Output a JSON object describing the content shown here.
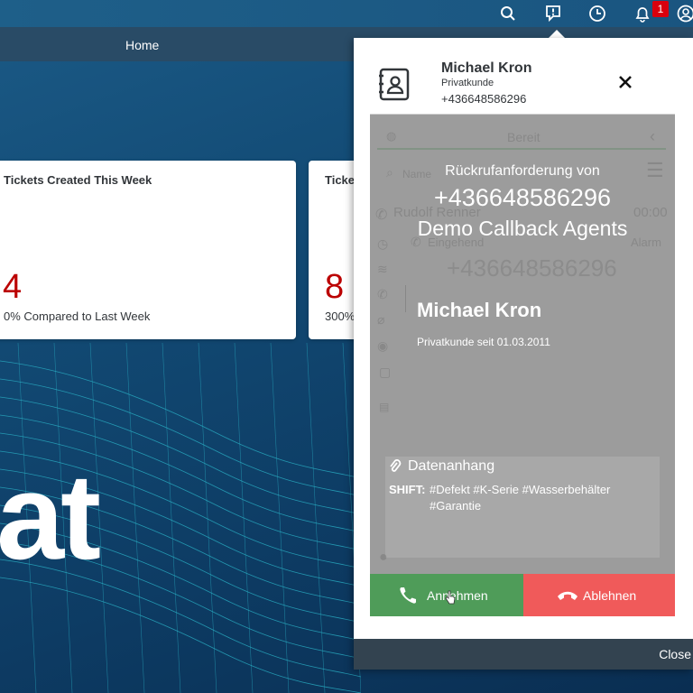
{
  "nav": {
    "home_label": "Home"
  },
  "topbar": {
    "icons": [
      "search-icon",
      "chat-alert-icon",
      "clock-icon",
      "bell-icon",
      "user-icon"
    ],
    "notification_count": "1"
  },
  "background": {
    "brand_text": "at"
  },
  "tiles": [
    {
      "title": "Tickets Created This Week",
      "value": "4",
      "subtitle": "0% Compared to Last Week"
    },
    {
      "title": "Ticke",
      "value": "8",
      "subtitle": "300%"
    }
  ],
  "popup": {
    "caller_name": "Michael Kron",
    "caller_type": "Privatkunde",
    "caller_phone": "+436648586296",
    "background": {
      "status": "Bereit",
      "search_placeholder": "Name",
      "agent_name": "Rudolf Renner",
      "timer": "00:00",
      "direction": "Eingehend",
      "alarm": "Alarm",
      "number": "+436648586296"
    },
    "overlay": {
      "request_label": "Rückrufanforderung von",
      "request_number": "+436648586296",
      "queue": "Demo Callback Agents",
      "customer_name": "Michael Kron",
      "customer_since": "Privatkunde seit 01.03.2011"
    },
    "attachment": {
      "title": "Datenanhang",
      "shift_label": "SHIFT:",
      "shift_tags_line1": "#Defekt #K-Serie #Wasserbehälter",
      "shift_tags_line2": "#Garantie"
    },
    "accept_label": "Annehmen",
    "reject_label": "Ablehnen",
    "footer_close": "Close"
  },
  "colors": {
    "accept": "#4f9c59",
    "reject": "#f05a5a",
    "kpi_value": "#bb0000",
    "panel_overlay": "#9c9c9c"
  }
}
